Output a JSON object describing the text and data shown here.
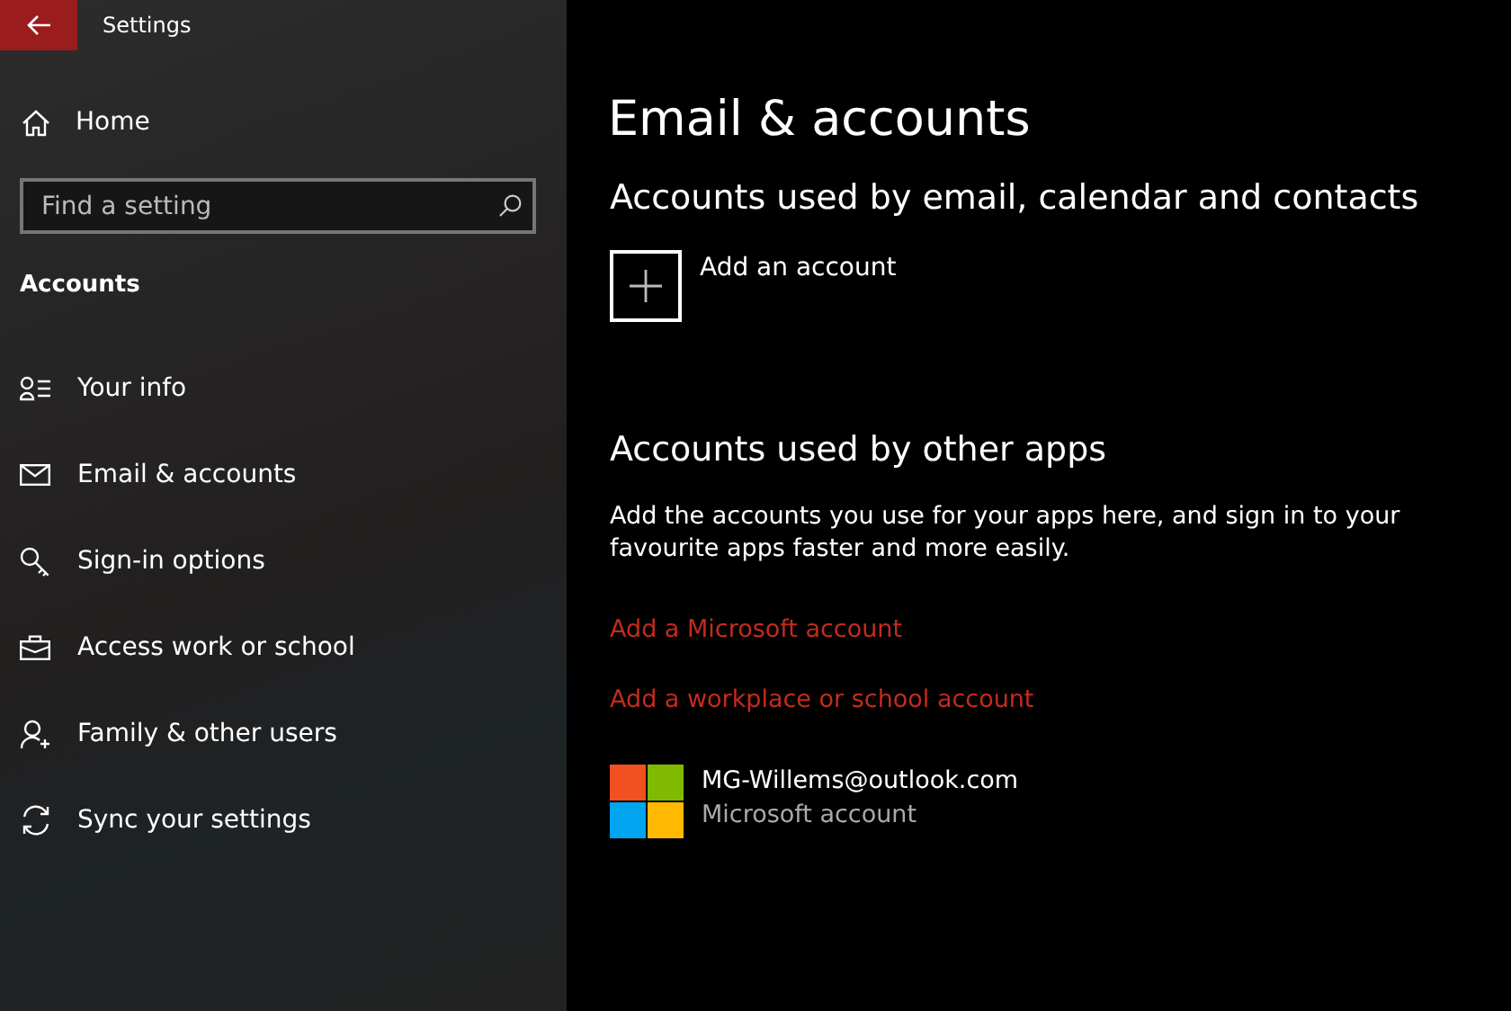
{
  "window": {
    "title": "Settings"
  },
  "sidebar": {
    "home": "Home",
    "search": {
      "placeholder": "Find a setting"
    },
    "section": "Accounts",
    "items": [
      {
        "label": "Your info"
      },
      {
        "label": "Email & accounts"
      },
      {
        "label": "Sign-in options"
      },
      {
        "label": "Access work or school"
      },
      {
        "label": "Family & other users"
      },
      {
        "label": "Sync your settings"
      }
    ]
  },
  "main": {
    "title": "Email & accounts",
    "section_1": {
      "heading": "Accounts used by email, calendar and contacts",
      "add": "Add an account"
    },
    "section_2": {
      "heading": "Accounts used by other apps",
      "description": "Add the accounts you use for your apps here, and sign in to your favourite apps faster and more easily.",
      "links": [
        "Add a Microsoft account",
        "Add a workplace or school account"
      ],
      "account": {
        "email": "MG-Willems@outlook.com",
        "type": "Microsoft account"
      }
    }
  }
}
